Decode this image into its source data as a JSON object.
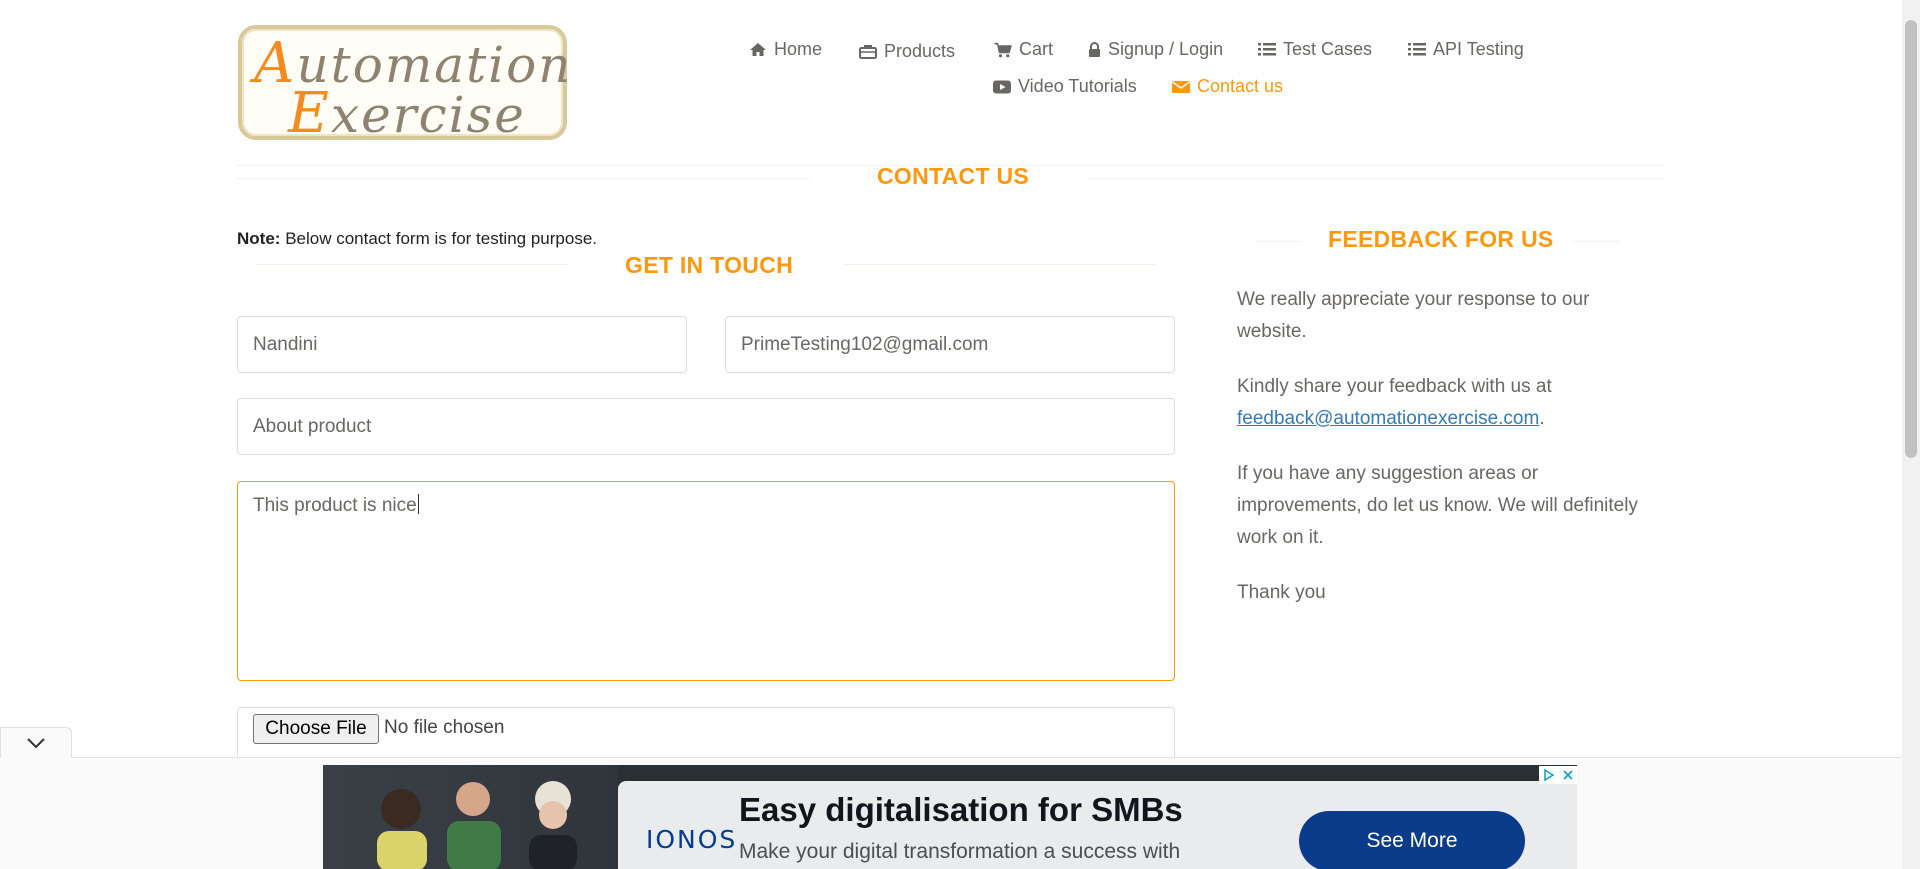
{
  "logo": {
    "line1_cap": "A",
    "line1_rest": "utomation",
    "line2_cap": "E",
    "line2_rest": "xercise"
  },
  "nav": [
    {
      "label": "Home",
      "icon": "home-icon"
    },
    {
      "label": "Products",
      "icon": "briefcase-icon"
    },
    {
      "label": "Cart",
      "icon": "shopping-cart-icon"
    },
    {
      "label": "Signup / Login",
      "icon": "lock-icon"
    },
    {
      "label": "Test Cases",
      "icon": "list-icon"
    },
    {
      "label": "API Testing",
      "icon": "list-icon"
    },
    {
      "label": "Video Tutorials",
      "icon": "youtube-play-icon"
    },
    {
      "label": "Contact us",
      "icon": "envelope-icon",
      "active": true
    }
  ],
  "page": {
    "title": "CONTACT US",
    "note_label": "Note:",
    "note_text": "Below contact form is for testing purpose."
  },
  "form": {
    "title": "GET IN TOUCH",
    "name_value": "Nandini",
    "email_value": "PrimeTesting102@gmail.com",
    "subject_value": "About product",
    "message_value": "This product is nice",
    "file_button": "Choose File",
    "file_status": "No file chosen"
  },
  "feedback": {
    "title": "FEEDBACK FOR US",
    "p1": "We really appreciate your response to our website.",
    "p2_text": "Kindly share your feedback with us at",
    "p2_link": "feedback@automationexercise.com",
    "p2_end": ".",
    "p3": "If you have any suggestion areas or improvements, do let us know. We will definitely work on it.",
    "p4": "Thank you"
  },
  "ad": {
    "brand": "IONOS",
    "headline": "Easy digitalisation for SMBs",
    "subtext": "Make your digital transformation a success with",
    "button": "See More"
  },
  "colors": {
    "accent": "#FE980F",
    "text": "#696763",
    "link": "#337AB7",
    "ad_button": "#0B3C8C"
  }
}
